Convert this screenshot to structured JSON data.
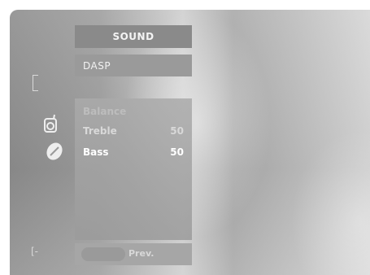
{
  "menu": {
    "title": "SOUND",
    "selected_item": "DASP"
  },
  "panel": {
    "rows": [
      {
        "label": "Balance",
        "value": ""
      },
      {
        "label": "Treble",
        "value": "50"
      },
      {
        "label": "Bass",
        "value": "50"
      }
    ]
  },
  "footer": {
    "prev_label": "Prev."
  },
  "icons": {
    "bracket": "bracket-icon",
    "sound": "speaker-icon",
    "picture": "picture-icon",
    "exit": "exit-icon"
  }
}
